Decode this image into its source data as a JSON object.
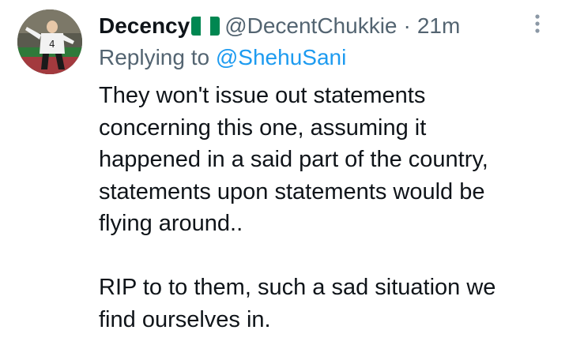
{
  "tweet": {
    "author": {
      "display_name": "Decency",
      "flag_icon": "nigeria-flag-icon",
      "handle": "@DecentChukkie",
      "separator": "·",
      "time": "21m"
    },
    "reply": {
      "prefix": "Replying to",
      "handle": "@ShehuSani"
    },
    "body": {
      "paragraph_1": "They won't issue out statements\nconcerning this one, assuming it\nhappened in a said part of the country,\nstatements upon statements would be\nflying around..",
      "paragraph_2": "RIP to to them, such a sad situation we\nfind ourselves in."
    },
    "menu_icon": "more-vertical-icon"
  },
  "colors": {
    "text_primary": "#0f1419",
    "text_secondary": "#536471",
    "link_blue": "#1d9bf0",
    "flag_green": "#008751",
    "background": "#ffffff"
  }
}
